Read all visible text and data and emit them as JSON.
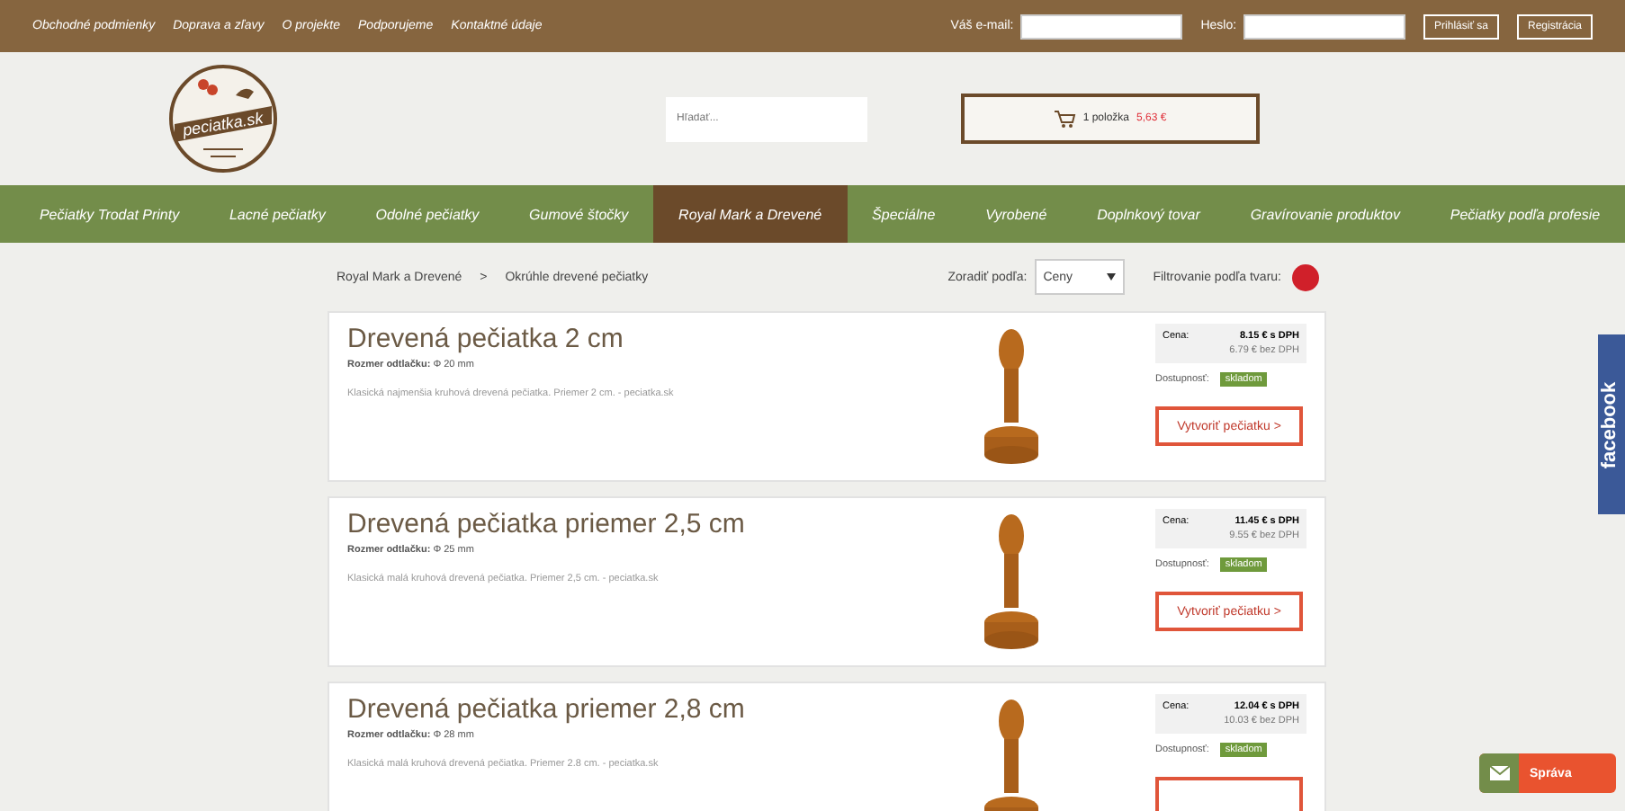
{
  "top_links": [
    "Obchodné podmienky",
    "Doprava a zľavy",
    "O projekte",
    "Podporujeme",
    "Kontaktné údaje"
  ],
  "login": {
    "email_label": "Váš e-mail:",
    "password_label": "Heslo:",
    "buttons": [
      "Prihlásiť sa",
      "Registrácia"
    ]
  },
  "logo": {
    "text": "peciatka.sk"
  },
  "search": {
    "placeholder": "Hľadať..."
  },
  "cart": {
    "label": "1 položka",
    "price": "5,63 €"
  },
  "nav": [
    {
      "label": "Pečiatky Trodat Printy",
      "selected": false
    },
    {
      "label": "Lacné pečiatky",
      "selected": false
    },
    {
      "label": "Odolné pečiatky",
      "selected": false
    },
    {
      "label": "Gumové štočky",
      "selected": false
    },
    {
      "label": "Royal Mark a Drevené",
      "selected": true
    },
    {
      "label": "Špeciálne",
      "selected": false
    },
    {
      "label": "Vyrobené",
      "selected": false
    },
    {
      "label": "Doplnkový tovar",
      "selected": false
    },
    {
      "label": "Gravírovanie produktov",
      "selected": false
    },
    {
      "label": "Pečiatky podľa profesie",
      "selected": false
    }
  ],
  "breadcrumb": [
    "Royal Mark a Drevené",
    "Okrúhle drevené pečiatky"
  ],
  "breadcrumb_separator": ">",
  "sort": {
    "label": "Zoradiť podľa:",
    "value": "Ceny"
  },
  "filter": {
    "label": "Filtrovanie podľa tvaru:",
    "color": "#d0202a"
  },
  "products": [
    {
      "title": "Drevená pečiatka 2 cm",
      "size_label": "Rozmer odtlačku:",
      "size": "Φ 20 mm",
      "description": "Klasická najmenšia kruhová drevená pečiatka. Priemer 2 cm. - peciatka.sk",
      "price_label": "Cena:",
      "price_vat": "8.15 € s DPH",
      "price_novat": "6.79 € bez DPH",
      "availability_label": "Dostupnosť:",
      "availability": "skladom",
      "cta": "Vytvoriť pečiatku >"
    },
    {
      "title": "Drevená pečiatka priemer 2,5 cm",
      "size_label": "Rozmer odtlačku:",
      "size": "Φ 25 mm",
      "description": "Klasická malá kruhová drevená pečiatka. Priemer 2,5 cm. - peciatka.sk",
      "price_label": "Cena:",
      "price_vat": "11.45 € s DPH",
      "price_novat": "9.55 € bez DPH",
      "availability_label": "Dostupnosť:",
      "availability": "skladom",
      "cta": "Vytvoriť pečiatku >"
    },
    {
      "title": "Drevená pečiatka priemer 2,8 cm",
      "size_label": "Rozmer odtlačku:",
      "size": "Φ 28 mm",
      "description": "Klasická malá kruhová drevená pečiatka. Priemer 2.8 cm. - peciatka.sk",
      "price_label": "Cena:",
      "price_vat": "12.04 € s DPH",
      "price_novat": "10.03 € bez DPH",
      "availability_label": "Dostupnosť:",
      "availability": "skladom"
    }
  ],
  "facebook_tab": {
    "label": "facebook"
  },
  "message_button": {
    "label": "Správa"
  }
}
